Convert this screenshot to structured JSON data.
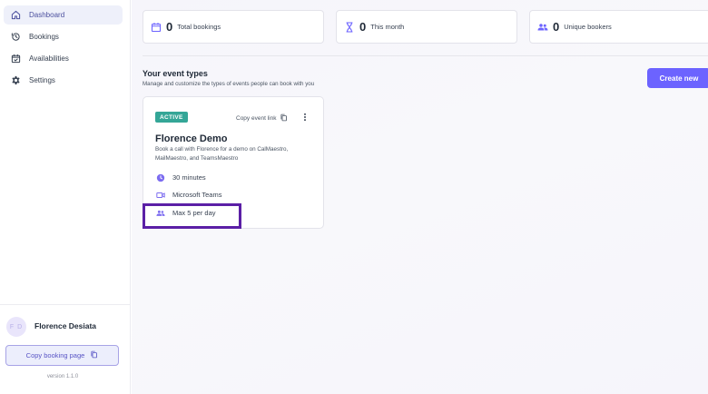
{
  "sidebar": {
    "items": [
      {
        "label": "Dashboard",
        "icon": "home-icon",
        "active": true
      },
      {
        "label": "Bookings",
        "icon": "history-icon",
        "active": false
      },
      {
        "label": "Availabilities",
        "icon": "calendar-check-icon",
        "active": false
      },
      {
        "label": "Settings",
        "icon": "gear-icon",
        "active": false
      }
    ],
    "user": {
      "initials": "F D",
      "name": "Florence Desiata"
    },
    "copy_booking_label": "Copy booking page",
    "version": "version 1.1.0"
  },
  "stats": [
    {
      "value": "0",
      "label": "Total bookings",
      "icon": "calendar-icon"
    },
    {
      "value": "0",
      "label": "This month",
      "icon": "hourglass-icon"
    },
    {
      "value": "0",
      "label": "Unique bookers",
      "icon": "people-icon"
    }
  ],
  "event_types": {
    "title": "Your event types",
    "subtitle": "Manage and customize the types of events people can book with you",
    "create_label": "Create new"
  },
  "event_card": {
    "badge": "ACTIVE",
    "copy_link_label": "Copy event link",
    "title": "Florence Demo",
    "description": "Book a call with Florence for a demo on CalMaestro, MailMaestro, and TeamsMaestro",
    "duration": "30 minutes",
    "location": "Microsoft Teams",
    "limit": "Max 5 per day"
  },
  "colors": {
    "accent": "#6c63ff",
    "active_badge": "#34a697",
    "highlight": "#5b1fa6"
  }
}
